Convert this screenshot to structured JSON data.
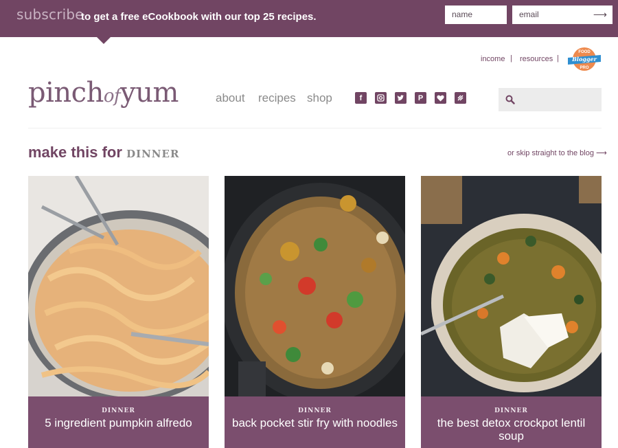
{
  "subscribe": {
    "word": "subscribe",
    "text": "to get a free eCookbook with our top 25 recipes.",
    "name_placeholder": "name",
    "email_placeholder": "email",
    "submit_icon": "arrow-right-icon"
  },
  "util_links": {
    "income": "income",
    "resources": "resources",
    "separator": "|"
  },
  "badge": {
    "lines": [
      "FOOD",
      "Blogger",
      "PRO"
    ]
  },
  "logo": {
    "part1": "pinch",
    "part2": "of",
    "part3": "yum"
  },
  "nav": [
    "about",
    "recipes",
    "shop"
  ],
  "social": [
    "facebook-icon",
    "instagram-icon",
    "twitter-icon",
    "pinterest-icon",
    "bloglovin-icon",
    "feed-icon"
  ],
  "section": {
    "heading": "make this for",
    "highlight": "DINNER",
    "skip_link": "or skip straight to the blog"
  },
  "cards": [
    {
      "category": "DINNER",
      "title": "5 ingredient pumpkin alfredo"
    },
    {
      "category": "DINNER",
      "title": "back pocket stir fry with noodles"
    },
    {
      "category": "DINNER",
      "title": "the best detox crockpot lentil soup"
    }
  ],
  "colors": {
    "brand": "#714563",
    "caption": "#7b4e6e",
    "nav": "#8a8a8a",
    "search_bg": "#ececec"
  }
}
